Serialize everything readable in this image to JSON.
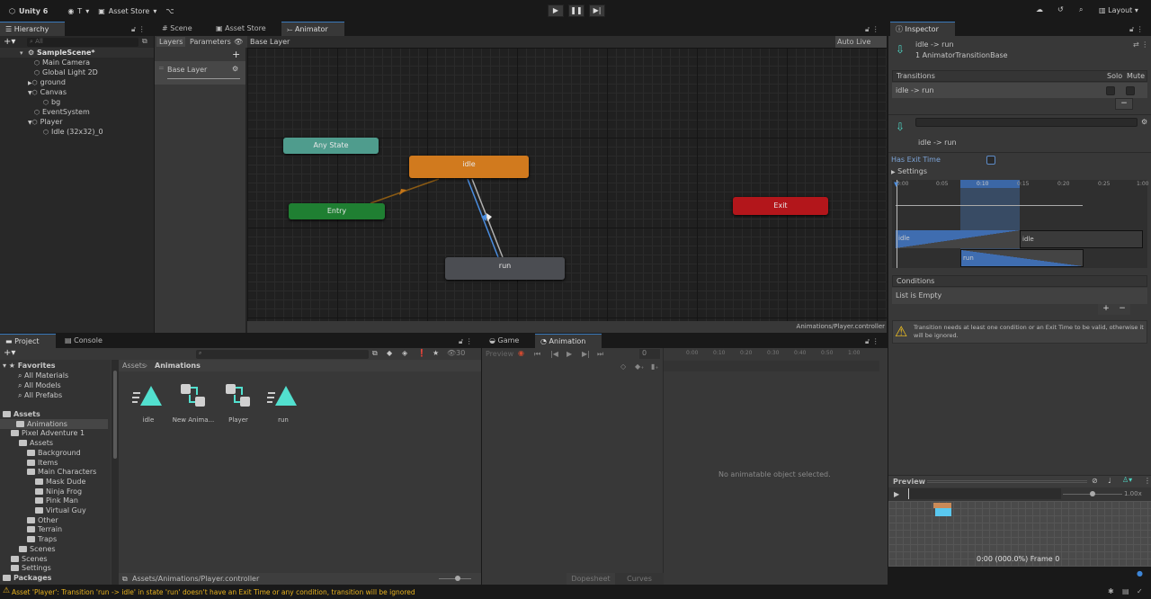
{
  "topbar": {
    "app": "Unity 6",
    "account": "T",
    "asset_store": "Asset Store",
    "layout": "Layout"
  },
  "tabs": {
    "hierarchy": "Hierarchy",
    "scene": "Scene",
    "asset_store": "Asset Store",
    "animator": "Animator",
    "inspector": "Inspector",
    "project": "Project",
    "console": "Console",
    "game": "Game",
    "animation": "Animation"
  },
  "hierarchy": {
    "search_placeholder": "All",
    "items": [
      {
        "label": "SampleScene*",
        "depth": 0,
        "expanded": true
      },
      {
        "label": "Main Camera",
        "depth": 1
      },
      {
        "label": "Global Light 2D",
        "depth": 1
      },
      {
        "label": "ground",
        "depth": 1,
        "collapsed": true
      },
      {
        "label": "Canvas",
        "depth": 1,
        "expanded": true
      },
      {
        "label": "bg",
        "depth": 2
      },
      {
        "label": "EventSystem",
        "depth": 1
      },
      {
        "label": "Player",
        "depth": 1,
        "expanded": true
      },
      {
        "label": "Idle (32x32)_0",
        "depth": 2
      }
    ]
  },
  "animator": {
    "layers_tab": "Layers",
    "parameters_tab": "Parameters",
    "breadcrumb": "Base Layer",
    "auto_live_link": "Auto Live Link",
    "layer_name": "Base Layer",
    "footer_path": "Animations/Player.controller",
    "states": {
      "any_state": "Any State",
      "idle": "idle",
      "entry": "Entry",
      "run": "run",
      "exit": "Exit"
    },
    "colors": {
      "any_state": "#4f9c8d",
      "idle": "#d17a1e",
      "entry": "#1f7f32",
      "run": "#4b4d52",
      "exit": "#b3161b",
      "selected_transition": "#4a8de0"
    }
  },
  "inspector": {
    "title": "idle -> run",
    "subtitle": "1 AnimatorTransitionBase",
    "transitions_header": "Transitions",
    "solo": "Solo",
    "mute": "Mute",
    "transition_row": "idle -> run",
    "transition_name": "idle -> run",
    "has_exit_time": "Has Exit Time",
    "has_exit_time_checked": false,
    "settings": "Settings",
    "timeline_ticks": [
      "0:00",
      "0:05",
      "0:10",
      "0:15",
      "0:20",
      "0:25",
      "1:00"
    ],
    "bars": {
      "source_a": "idle",
      "source_b": "idle",
      "dest": "run"
    },
    "conditions": "Conditions",
    "list_empty": "List is Empty",
    "warning": "Transition needs at least one condition or an Exit Time to be valid, otherwise it will be ignored.",
    "preview": "Preview",
    "preview_speed": "1.00x",
    "preview_status": "0:00 (000.0%) Frame 0"
  },
  "project": {
    "favorites": "Favorites",
    "fav_items": [
      "All Materials",
      "All Models",
      "All Prefabs"
    ],
    "tree": [
      {
        "label": "Assets",
        "depth": 0,
        "bold": true
      },
      {
        "label": "Animations",
        "depth": 1,
        "selected": true
      },
      {
        "label": "Pixel Adventure 1",
        "depth": 1
      },
      {
        "label": "Assets",
        "depth": 2
      },
      {
        "label": "Background",
        "depth": 3
      },
      {
        "label": "Items",
        "depth": 3
      },
      {
        "label": "Main Characters",
        "depth": 3
      },
      {
        "label": "Mask Dude",
        "depth": 4
      },
      {
        "label": "Ninja Frog",
        "depth": 4
      },
      {
        "label": "Pink Man",
        "depth": 4
      },
      {
        "label": "Virtual Guy",
        "depth": 4
      },
      {
        "label": "Other",
        "depth": 3
      },
      {
        "label": "Terrain",
        "depth": 3
      },
      {
        "label": "Traps",
        "depth": 3
      },
      {
        "label": "Scenes",
        "depth": 2
      },
      {
        "label": "Scenes",
        "depth": 1
      },
      {
        "label": "Settings",
        "depth": 1
      },
      {
        "label": "Packages",
        "depth": 0,
        "bold": true
      }
    ],
    "breadcrumb_root": "Assets",
    "breadcrumb_current": "Animations",
    "hidden_count": "30",
    "assets": [
      {
        "label": "idle",
        "type": "animation-clip"
      },
      {
        "label": "New Anima...",
        "type": "animator-controller"
      },
      {
        "label": "Player",
        "type": "animator-controller"
      },
      {
        "label": "run",
        "type": "animation-clip"
      }
    ],
    "footer_path": "Assets/Animations/Player.controller"
  },
  "animation": {
    "preview": "Preview",
    "frame": "0",
    "ticks": [
      "0:00",
      "0:10",
      "0:20",
      "0:30",
      "0:40",
      "0:50",
      "1:00"
    ],
    "empty": "No animatable object selected.",
    "dopesheet": "Dopesheet",
    "curves": "Curves"
  },
  "status": {
    "message": "Asset 'Player': Transition 'run -> idle' in state 'run' doesn't have an Exit Time or any condition, transition will be ignored",
    "color": "#e8b21e"
  }
}
